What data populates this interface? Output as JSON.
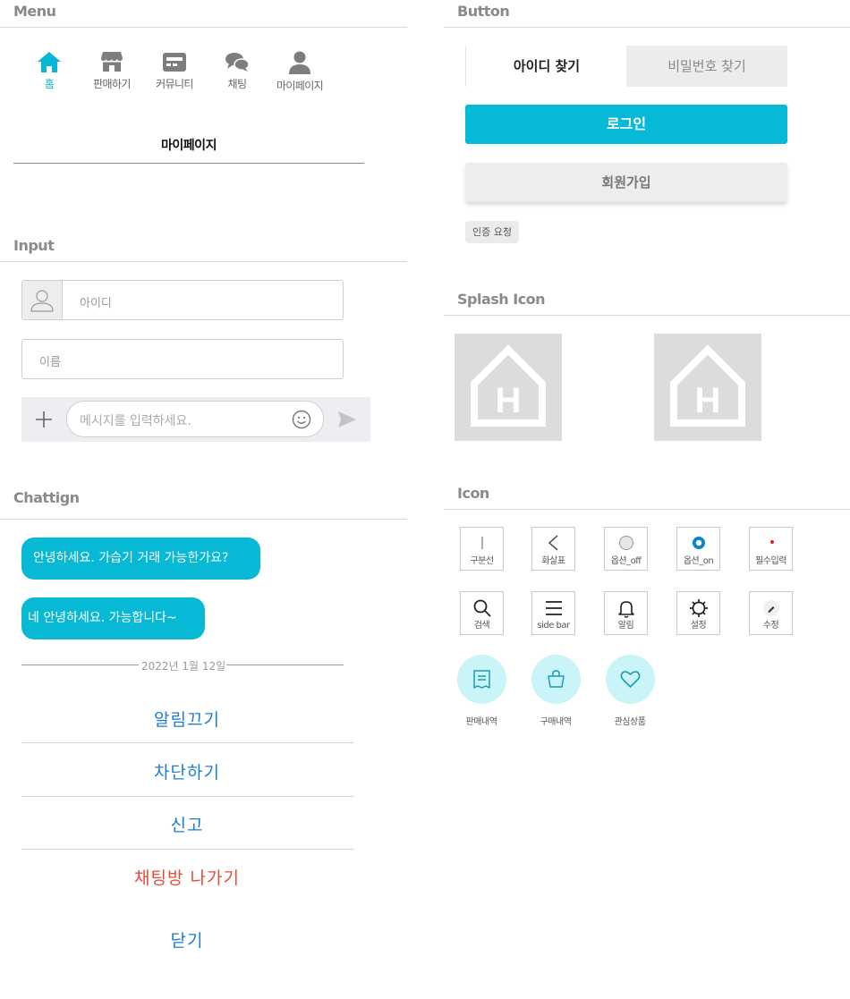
{
  "sections": {
    "menu": "Menu",
    "button": "Button",
    "input": "Input",
    "splash": "Splash Icon",
    "chatting": "Chattign",
    "icon": "Icon"
  },
  "menu": {
    "items": [
      {
        "label": "홈",
        "icon": "home-icon",
        "active": true
      },
      {
        "label": "판매하기",
        "icon": "store-icon"
      },
      {
        "label": "커뮤니티",
        "icon": "community-icon"
      },
      {
        "label": "채팅",
        "icon": "chat-icon"
      },
      {
        "label": "마이페이지",
        "icon": "user-icon"
      }
    ],
    "page_header": "마이페이지"
  },
  "inputs": {
    "id_placeholder": "아이디",
    "name_placeholder": "이름",
    "message_placeholder": "메시지를 입력하세요."
  },
  "chat": {
    "messages": [
      "안녕하세요. 가습기 거래 가능한가요?",
      "네 안녕하세요. 가능합니다~"
    ],
    "date": "2022년 1월 12일",
    "actions": [
      {
        "label": "알림끄기"
      },
      {
        "label": "차단하기"
      },
      {
        "label": "신고"
      },
      {
        "label": "채팅방 나가기",
        "danger": true
      },
      {
        "label": "닫기"
      }
    ]
  },
  "buttons": {
    "tab_find_id": "아이디 찾기",
    "tab_find_password": "비밀번호 찾기",
    "login": "로그인",
    "signup": "회원가입",
    "verify_request": "인증 요청"
  },
  "splash": {
    "letter": "H"
  },
  "icons": {
    "row1": [
      "구분선",
      "화살표",
      "옵션_off",
      "옵션_on",
      "필수입력"
    ],
    "row2": [
      "검색",
      "side bar",
      "알림",
      "설정",
      "수정"
    ],
    "round": [
      "판매내역",
      "구매내역",
      "관심상품"
    ]
  },
  "colors": {
    "accent": "#08b9d6",
    "link": "#1b7ed3",
    "danger": "#e84a3c",
    "required_dot": "#e02020",
    "option_on": "#0a86c5",
    "icon_bg": "#c9f4f8"
  }
}
